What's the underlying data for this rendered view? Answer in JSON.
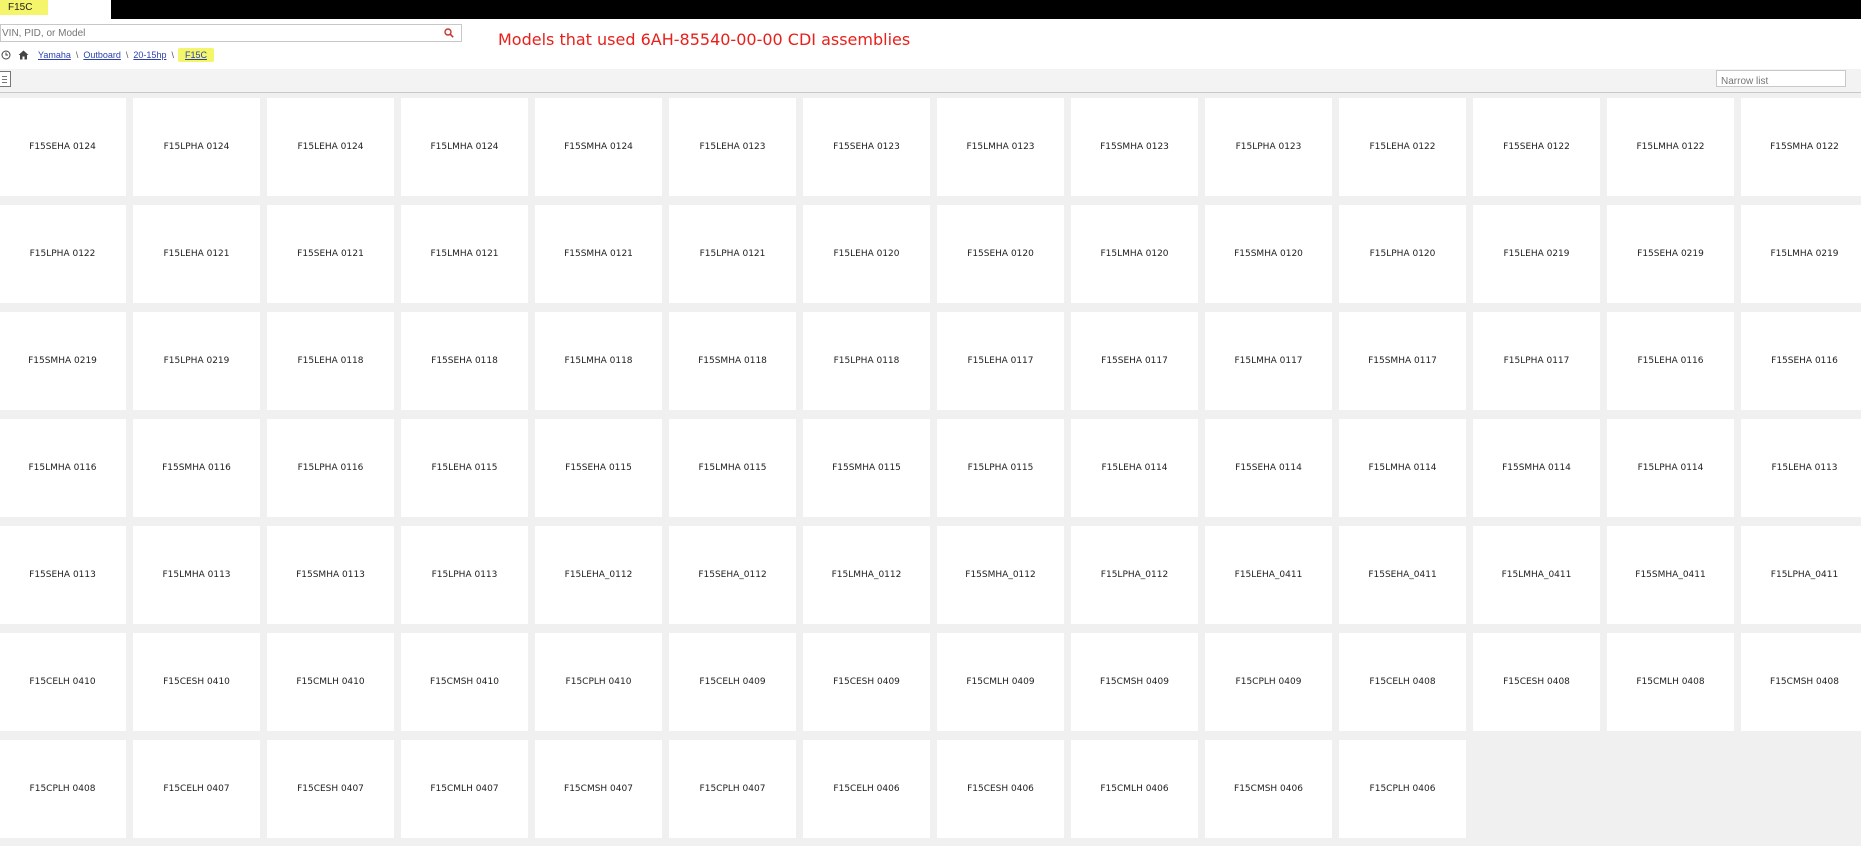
{
  "tab": {
    "label": "F15C"
  },
  "search": {
    "placeholder": "VIN, PID, or Model"
  },
  "breadcrumb": {
    "items": [
      "Yamaha",
      "Outboard",
      "20-15hp"
    ],
    "current": "F15C"
  },
  "heading": "Models that used 6AH-85540-00-00 CDI assemblies",
  "filter": {
    "placeholder": "Narrow list"
  },
  "models": [
    "F15SEHA 0124",
    "F15LPHA 0124",
    "F15LEHA 0124",
    "F15LMHA 0124",
    "F15SMHA 0124",
    "F15LEHA 0123",
    "F15SEHA 0123",
    "F15LMHA 0123",
    "F15SMHA 0123",
    "F15LPHA 0123",
    "F15LEHA 0122",
    "F15SEHA 0122",
    "F15LMHA 0122",
    "F15SMHA 0122",
    "F15LPHA 0122",
    "F15LEHA 0121",
    "F15SEHA 0121",
    "F15LMHA 0121",
    "F15SMHA 0121",
    "F15LPHA 0121",
    "F15LEHA 0120",
    "F15SEHA 0120",
    "F15LMHA 0120",
    "F15SMHA 0120",
    "F15LPHA 0120",
    "F15LEHA 0219",
    "F15SEHA 0219",
    "F15LMHA 0219",
    "F15SMHA 0219",
    "F15LPHA 0219",
    "F15LEHA 0118",
    "F15SEHA 0118",
    "F15LMHA 0118",
    "F15SMHA 0118",
    "F15LPHA 0118",
    "F15LEHA 0117",
    "F15SEHA 0117",
    "F15LMHA 0117",
    "F15SMHA 0117",
    "F15LPHA 0117",
    "F15LEHA 0116",
    "F15SEHA 0116",
    "F15LMHA 0116",
    "F15SMHA 0116",
    "F15LPHA 0116",
    "F15LEHA 0115",
    "F15SEHA 0115",
    "F15LMHA 0115",
    "F15SMHA 0115",
    "F15LPHA 0115",
    "F15LEHA 0114",
    "F15SEHA 0114",
    "F15LMHA 0114",
    "F15SMHA 0114",
    "F15LPHA 0114",
    "F15LEHA 0113",
    "F15SEHA 0113",
    "F15LMHA 0113",
    "F15SMHA 0113",
    "F15LPHA 0113",
    "F15LEHA_0112",
    "F15SEHA_0112",
    "F15LMHA_0112",
    "F15SMHA_0112",
    "F15LPHA_0112",
    "F15LEHA_0411",
    "F15SEHA_0411",
    "F15LMHA_0411",
    "F15SMHA_0411",
    "F15LPHA_0411",
    "F15CELH 0410",
    "F15CESH 0410",
    "F15CMLH 0410",
    "F15CMSH 0410",
    "F15CPLH 0410",
    "F15CELH 0409",
    "F15CESH 0409",
    "F15CMLH 0409",
    "F15CMSH 0409",
    "F15CPLH 0409",
    "F15CELH 0408",
    "F15CESH 0408",
    "F15CMLH 0408",
    "F15CMSH 0408",
    "F15CPLH 0408",
    "F15CELH 0407",
    "F15CESH 0407",
    "F15CMLH 0407",
    "F15CMSH 0407",
    "F15CPLH 0407",
    "F15CELH 0406",
    "F15CESH 0406",
    "F15CMLH 0406",
    "F15CMSH 0406",
    "F15CPLH 0406"
  ]
}
